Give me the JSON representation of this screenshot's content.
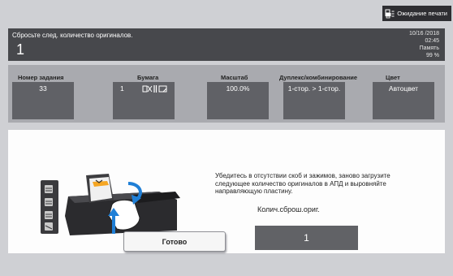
{
  "top": {
    "wait_label": "Ожидание печати",
    "wait_icon": "printer-queue-icon"
  },
  "message": {
    "text": "Сбросьте след. количество оригиналов.",
    "count": "1"
  },
  "status": {
    "date": "10/16 /2018",
    "time": "02:45",
    "memory_label": "Память",
    "memory_value": "99 %"
  },
  "settings": {
    "job": {
      "label": "Номер задания",
      "value": "33"
    },
    "paper": {
      "label": "Бумага",
      "value": "1",
      "icons": "paper-size-icons"
    },
    "scale": {
      "label": "Масштаб",
      "value": "100.0%"
    },
    "duplex": {
      "label": "Дуплекс/комбинирование",
      "value": "1-стор. > 1-стор."
    },
    "color": {
      "label": "Цвет",
      "value": "Автоцвет"
    }
  },
  "main": {
    "instruction": "Убедитесь в отсутствии скоб и зажимов, заново загрузите следующее количество оригиналов в АПД и выровняйте направляющую пластину.",
    "count_label": "Колич.сброш.ориг.",
    "count_value": "1",
    "ok_label": "Готово",
    "illustration": "adf-reload-illustration"
  },
  "colors": {
    "dark_bar": "#47484c",
    "settings_panel": "#a9aaaf",
    "value_box": "#606166",
    "accent_blue": "#1f7fd6"
  }
}
